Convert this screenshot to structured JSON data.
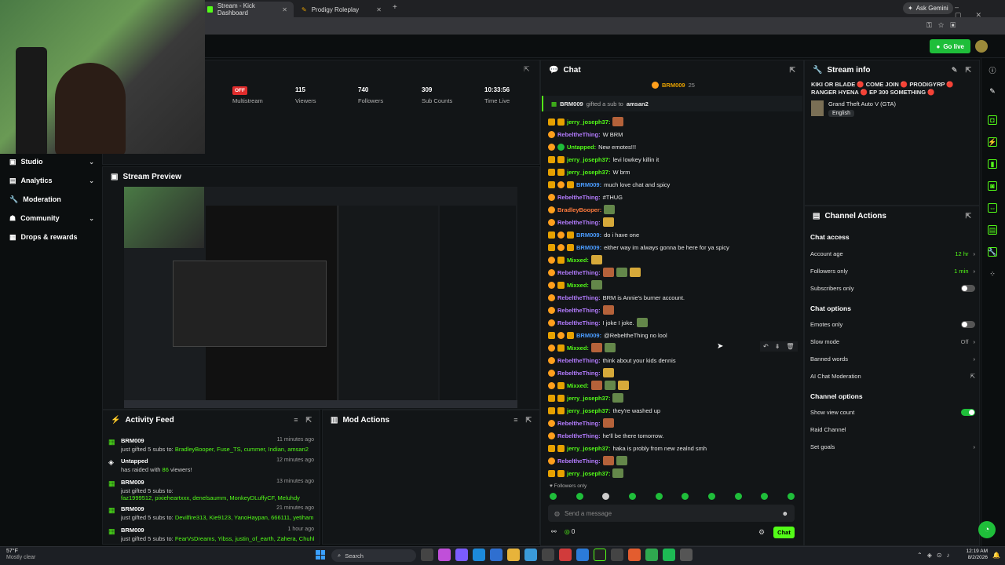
{
  "browser": {
    "tabs": [
      {
        "label": "Stream - Kick Dashboard",
        "active": true
      },
      {
        "label": "Prodigy Roleplay",
        "active": false
      }
    ],
    "ask_gemini": "Ask Gemini"
  },
  "topbar": {
    "go_live": "Go live"
  },
  "sidebar": {
    "items": [
      {
        "label": "Studio",
        "has_chevron": true
      },
      {
        "label": "Analytics",
        "has_chevron": true
      },
      {
        "label": "Moderation",
        "has_chevron": false
      },
      {
        "label": "Community",
        "has_chevron": true
      },
      {
        "label": "Drops & rewards",
        "has_chevron": false
      }
    ]
  },
  "stats": {
    "off_badge": "OFF",
    "multistream_label": "Multistream",
    "viewers": {
      "value": "115",
      "label": "Viewers"
    },
    "followers": {
      "value": "740",
      "label": "Followers"
    },
    "subs": {
      "value": "309",
      "label": "Sub Counts"
    },
    "time": {
      "value": "10:33:56",
      "label": "Time Live"
    }
  },
  "preview": {
    "title": "Stream Preview"
  },
  "activity": {
    "title": "Activity Feed",
    "items": [
      {
        "user": "BRM009",
        "time": "11 minutes ago",
        "text": "just gifted 5 subs to:",
        "detail": "BradleyBooper, Fuse_TS, cummer, Indian, amsan2"
      },
      {
        "user": "Untapped",
        "time": "12 minutes ago",
        "text": "has raided with",
        "count": "86",
        "suffix": "viewers!"
      },
      {
        "user": "BRM009",
        "time": "13 minutes ago",
        "text": "just gifted 5 subs to:",
        "detail": "faz1999512, pixieheartxxx, denelsaumm, MonkeyDLuffyCF, Meluhdy"
      },
      {
        "user": "BRM009",
        "time": "21 minutes ago",
        "text": "just gifted 5 subs to:",
        "detail": "Devilfire313, Kie9123, YanoHaypan, 666111, yetihammond"
      },
      {
        "user": "BRM009",
        "time": "1 hour ago",
        "text": "just gifted 5 subs to:",
        "detail": "FearVsDreams, Yibss, justin_of_earth, Zahera, Chuhbeee"
      }
    ]
  },
  "mod_actions": {
    "title": "Mod Actions"
  },
  "chat": {
    "title": "Chat",
    "pinned_user": "BRM009",
    "pinned_count": "25",
    "gift_user": "BRM009",
    "gift_text": "gifted a sub to",
    "gift_target": "amsan2",
    "messages": [
      {
        "user": "jerry_joseph37",
        "text": "",
        "color": "#53fc18",
        "badges": [
          "crown",
          "crown"
        ],
        "emotes": 1
      },
      {
        "user": "RebeltheThing",
        "text": "W BRM",
        "color": "#b47cff",
        "badges": [
          "sub"
        ],
        "emotes": 0
      },
      {
        "user": "Untapped",
        "text": "New emotes!!!",
        "color": "#53fc18",
        "badges": [
          "sub",
          "verified"
        ],
        "emotes": 0
      },
      {
        "user": "jerry_joseph37",
        "text": "levi lowkey killin it",
        "color": "#53fc18",
        "badges": [
          "crown",
          "crown"
        ],
        "emotes": 0
      },
      {
        "user": "jerry_joseph37",
        "text": "W brm",
        "color": "#53fc18",
        "badges": [
          "crown",
          "crown"
        ],
        "emotes": 0
      },
      {
        "user": "BRM009",
        "text": "much love chat and spicy",
        "color": "#4a9cff",
        "badges": [
          "crown",
          "sub",
          "crown"
        ],
        "emotes": 0
      },
      {
        "user": "RebeltheThing",
        "text": "#THUG",
        "color": "#b47cff",
        "badges": [
          "sub"
        ],
        "emotes": 0
      },
      {
        "user": "BradleyBooper",
        "text": "",
        "color": "#ff7a3d",
        "badges": [
          "sub"
        ],
        "emotes": 1
      },
      {
        "user": "RebeltheThing",
        "text": "",
        "color": "#b47cff",
        "badges": [
          "sub"
        ],
        "emotes": 1
      },
      {
        "user": "BRM009",
        "text": "do i have one",
        "color": "#4a9cff",
        "badges": [
          "crown",
          "sub",
          "crown"
        ],
        "emotes": 0
      },
      {
        "user": "BRM009",
        "text": "either way im always gonna be here for ya spicy",
        "color": "#4a9cff",
        "badges": [
          "crown",
          "sub",
          "crown"
        ],
        "emotes": 0
      },
      {
        "user": "Mixxed",
        "text": "",
        "color": "#53fc18",
        "badges": [
          "sub",
          "crown"
        ],
        "emotes": 1
      },
      {
        "user": "RebeltheThing",
        "text": "",
        "color": "#b47cff",
        "badges": [
          "sub"
        ],
        "emotes": 3
      },
      {
        "user": "Mixxed",
        "text": "",
        "color": "#53fc18",
        "badges": [
          "sub",
          "crown"
        ],
        "emotes": 1
      },
      {
        "user": "RebeltheThing",
        "text": "BRM is Annie's burner account.",
        "color": "#b47cff",
        "badges": [
          "sub"
        ],
        "emotes": 0
      },
      {
        "user": "RebeltheThing",
        "text": "",
        "color": "#b47cff",
        "badges": [
          "sub"
        ],
        "emotes": 1
      },
      {
        "user": "RebeltheThing",
        "text": "I joke I joke.",
        "color": "#b47cff",
        "badges": [
          "sub"
        ],
        "emotes": 1
      },
      {
        "user": "BRM009",
        "text": "@RebeltheThing no lool",
        "color": "#4a9cff",
        "badges": [
          "crown",
          "sub",
          "crown"
        ],
        "emotes": 0
      },
      {
        "user": "Mixxed",
        "text": "",
        "color": "#53fc18",
        "badges": [
          "sub",
          "crown"
        ],
        "emotes": 2
      },
      {
        "user": "RebeltheThing",
        "text": "think about your kids dennis",
        "color": "#b47cff",
        "badges": [
          "sub"
        ],
        "emotes": 0
      },
      {
        "user": "RebeltheThing",
        "text": "",
        "color": "#b47cff",
        "badges": [
          "sub"
        ],
        "emotes": 1
      },
      {
        "user": "Mixxed",
        "text": "",
        "color": "#53fc18",
        "badges": [
          "sub",
          "crown"
        ],
        "emotes": 3
      },
      {
        "user": "jerry_joseph37",
        "text": "",
        "color": "#53fc18",
        "badges": [
          "crown",
          "crown"
        ],
        "emotes": 1
      },
      {
        "user": "jerry_joseph37",
        "text": "they're washed up",
        "color": "#53fc18",
        "badges": [
          "crown",
          "crown"
        ],
        "emotes": 0
      },
      {
        "user": "RebeltheThing",
        "text": "",
        "color": "#b47cff",
        "badges": [
          "sub"
        ],
        "emotes": 1
      },
      {
        "user": "RebeltheThing",
        "text": "he'll be there tomorrow.",
        "color": "#b47cff",
        "badges": [
          "sub"
        ],
        "emotes": 0
      },
      {
        "user": "jerry_joseph37",
        "text": "haka is probly from new zealnd smh",
        "color": "#53fc18",
        "badges": [
          "crown",
          "crown"
        ],
        "emotes": 0
      },
      {
        "user": "RebeltheThing",
        "text": "",
        "color": "#b47cff",
        "badges": [
          "sub"
        ],
        "emotes": 2
      },
      {
        "user": "jerry_joseph37",
        "text": "",
        "color": "#53fc18",
        "badges": [
          "crown",
          "crown"
        ],
        "emotes": 1
      }
    ],
    "followers_only": "Followers only",
    "input_placeholder": "Send a message",
    "points": "0",
    "send_label": "Chat"
  },
  "stream_info": {
    "title": "Stream info",
    "stream_title": "KIKI OR BLADE 🔴 COME JOIN 🔴 PRODIGYRP 🔴 RANGER HYENA 🔴 EP 300 SOMETHING 🔴",
    "category": "Grand Theft Auto V (GTA)",
    "language": "English"
  },
  "channel_actions": {
    "title": "Channel Actions",
    "chat_access": "Chat access",
    "account_age": {
      "label": "Account age",
      "value": "12 hr"
    },
    "followers_only": {
      "label": "Followers only",
      "value": "1 min"
    },
    "subscribers_only": {
      "label": "Subscribers only",
      "on": false
    },
    "chat_options": "Chat options",
    "emotes_only": {
      "label": "Emotes only",
      "on": false
    },
    "slow_mode": {
      "label": "Slow mode",
      "value": "Off"
    },
    "banned_words": {
      "label": "Banned words"
    },
    "ai_moderation": {
      "label": "AI Chat Moderation"
    },
    "channel_options": "Channel options",
    "show_view_count": {
      "label": "Show view count",
      "on": true
    },
    "raid_channel": {
      "label": "Raid Channel"
    },
    "set_goals": {
      "label": "Set goals"
    }
  },
  "taskbar": {
    "weather_temp": "57°F",
    "weather_desc": "Mostly clear",
    "search": "Search",
    "time": "12:19 AM",
    "date": "8/2/2026"
  },
  "colors": {
    "accent": "#53fc18",
    "background": "#0b0e0f",
    "panel": "#121517"
  }
}
